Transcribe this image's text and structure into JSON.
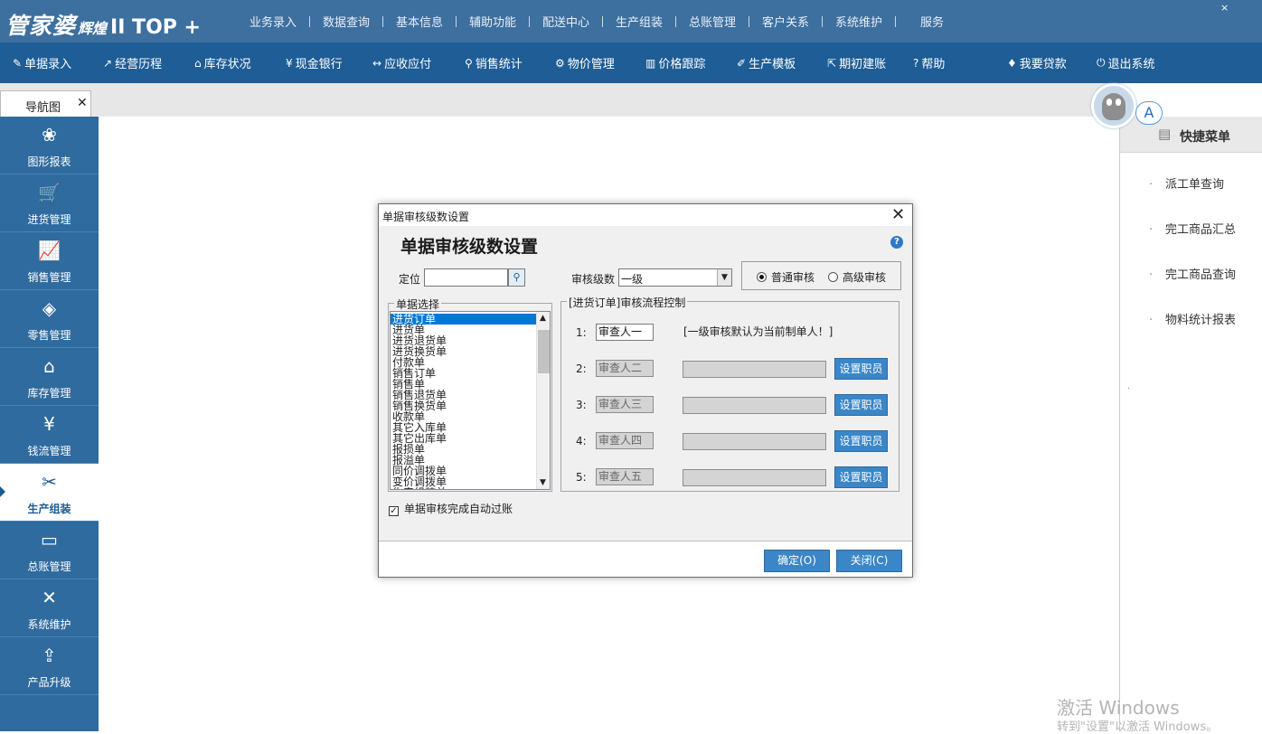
{
  "app": {
    "logo_main": "管家婆",
    "logo_sub": "辉煌",
    "logo_edition": "II TOP +",
    "close_glyph": "×"
  },
  "top_menu": [
    "业务录入",
    "数据查询",
    "基本信息",
    "辅助功能",
    "配送中心",
    "生产组装",
    "总账管理",
    "客户关系",
    "系统维护",
    "服务"
  ],
  "toolbar": [
    {
      "label": "单据录入",
      "icon": "document-edit-icon",
      "glyph": "✎"
    },
    {
      "label": "经营历程",
      "icon": "trend-icon",
      "glyph": "↗"
    },
    {
      "label": "库存状况",
      "icon": "home-icon",
      "glyph": "⌂"
    },
    {
      "label": "现金银行",
      "icon": "yen-icon",
      "glyph": "¥"
    },
    {
      "label": "应收应付",
      "icon": "exchange-icon",
      "glyph": "↔"
    },
    {
      "label": "销售统计",
      "icon": "search-icon",
      "glyph": "⚲"
    },
    {
      "label": "物价管理",
      "icon": "gear-icon",
      "glyph": "⚙"
    },
    {
      "label": "价格跟踪",
      "icon": "bar-chart-icon",
      "glyph": "▥"
    },
    {
      "label": "生产模板",
      "icon": "wrench-icon",
      "glyph": "✐"
    },
    {
      "label": "期初建账",
      "icon": "external-link-icon",
      "glyph": "⇱"
    },
    {
      "label": "帮助",
      "icon": "question-icon",
      "glyph": "?"
    },
    {
      "label": "我要贷款",
      "icon": "money-bag-icon",
      "glyph": "♦"
    },
    {
      "label": "退出系统",
      "icon": "power-icon",
      "glyph": "⏻"
    }
  ],
  "tab": {
    "label": "导航图",
    "close": "✕"
  },
  "sidebar": [
    {
      "label": "图形报表",
      "icon": "graph-report-icon",
      "glyph": "❀"
    },
    {
      "label": "进货管理",
      "icon": "cart-icon",
      "glyph": "🛒"
    },
    {
      "label": "销售管理",
      "icon": "line-chart-icon",
      "glyph": "📈"
    },
    {
      "label": "零售管理",
      "icon": "tag-icon",
      "glyph": "◈"
    },
    {
      "label": "库存管理",
      "icon": "house-icon",
      "glyph": "⌂"
    },
    {
      "label": "钱流管理",
      "icon": "cash-icon",
      "glyph": "¥"
    },
    {
      "label": "生产组装",
      "icon": "wrench-icon",
      "glyph": "✂",
      "active": true
    },
    {
      "label": "总账管理",
      "icon": "monitor-icon",
      "glyph": "▭"
    },
    {
      "label": "系统维护",
      "icon": "tools-icon",
      "glyph": "✕"
    },
    {
      "label": "产品升级",
      "icon": "upload-icon",
      "glyph": "⇪"
    }
  ],
  "quick_menu": {
    "title": "快捷菜单",
    "items": [
      "派工单查询",
      "完工商品汇总",
      "完工商品查询",
      "物料统计报表"
    ],
    "bullet": "·"
  },
  "avatar_badge": "A",
  "watermark": {
    "line1": "激活 Windows",
    "line2": "转到\"设置\"以激活 Windows。"
  },
  "dialog": {
    "window_title": "单据审核级数设置",
    "header": "单据审核级数设置",
    "help": "?",
    "close": "✕",
    "locate_label": "定位",
    "locate_value": "",
    "level_label": "审核级数",
    "level_value": "一级",
    "mode_options": [
      {
        "label": "普通审核",
        "selected": true
      },
      {
        "label": "高级审核",
        "selected": false
      }
    ],
    "doc_group_label": "单据选择",
    "doc_list": [
      "进货订单",
      "进货单",
      "进货退货单",
      "进货换货单",
      "付款单",
      "销售订单",
      "销售单",
      "销售退货单",
      "销售换货单",
      "收款单",
      "其它入库单",
      "其它出库单",
      "报损单",
      "报溢单",
      "同价调拨单",
      "变价调拨单",
      "生产组装单"
    ],
    "doc_selected_index": 0,
    "flow_group_label": "[进货订单]审核流程控制",
    "flow_note": "[一级审核默认为当前制单人！]",
    "flow_rows": [
      {
        "num": "1:",
        "value": "审查人一"
      },
      {
        "num": "2:",
        "value": "审查人二",
        "button": "设置职员"
      },
      {
        "num": "3:",
        "value": "审查人三",
        "button": "设置职员"
      },
      {
        "num": "4:",
        "value": "审查人四",
        "button": "设置职员"
      },
      {
        "num": "5:",
        "value": "审查人五",
        "button": "设置职员"
      }
    ],
    "auto_post_label": "单据审核完成自动过账",
    "auto_post_checked": true,
    "ok_button": "确定(O)",
    "close_button": "关闭(C)"
  }
}
